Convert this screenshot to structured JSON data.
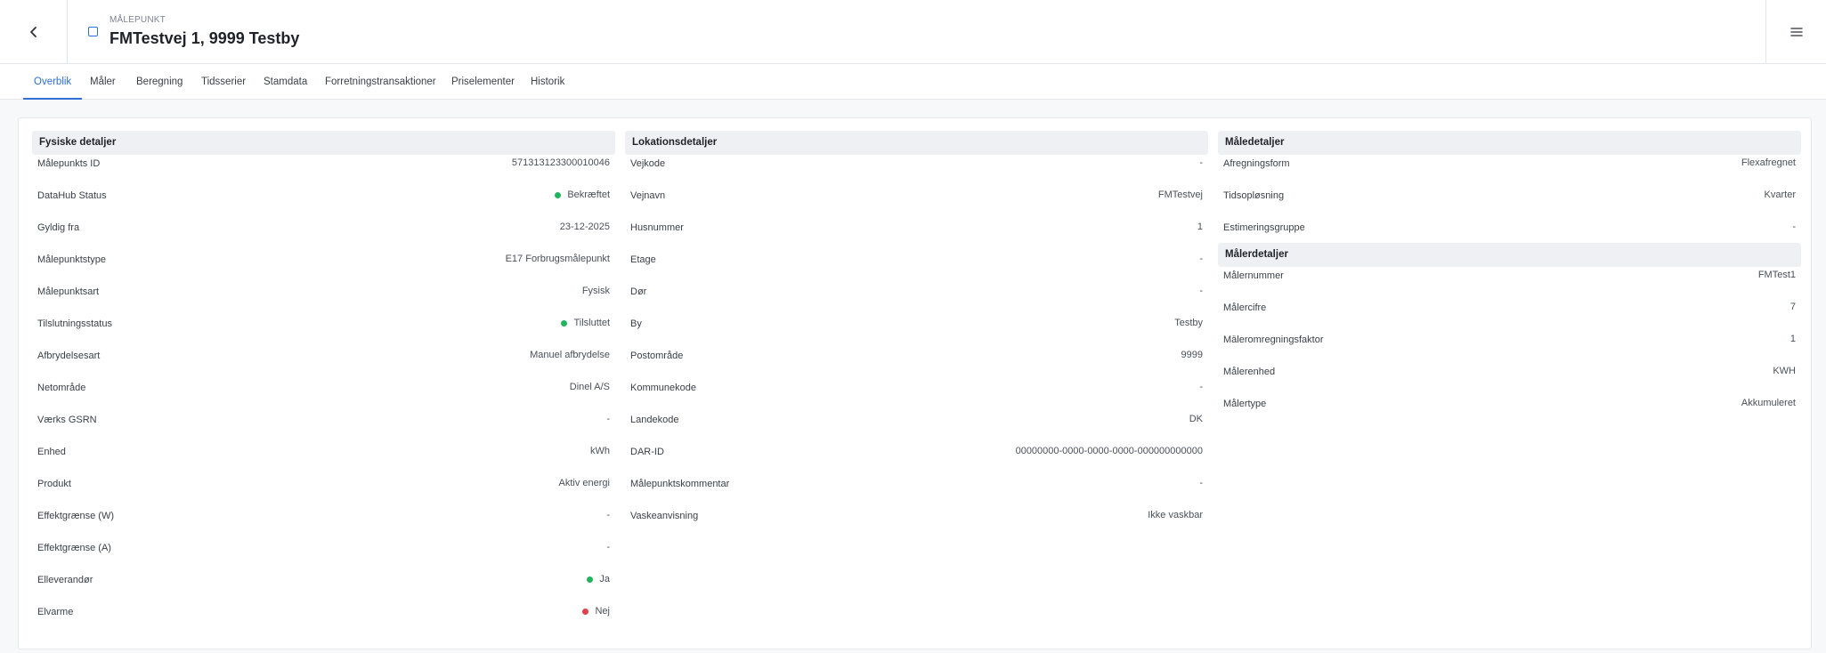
{
  "header": {
    "eyebrow": "MÅLEPUNKT",
    "title": "FMTestvej 1, 9999 Testby"
  },
  "tabs": [
    "Overblik",
    "Måler",
    "Beregning",
    "Tidsserier",
    "Stamdata",
    "Forretningstransaktioner",
    "Priselementer",
    "Historik"
  ],
  "active_tab": "Overblik",
  "physical": {
    "heading": "Fysiske detaljer",
    "rows": [
      {
        "label": "Målepunkts ID",
        "value": "571313123300010046"
      },
      {
        "label": "DataHub Status",
        "value": "Bekræftet",
        "status": "green"
      },
      {
        "label": "Gyldig fra",
        "value": "23-12-2025"
      },
      {
        "label": "Målepunktstype",
        "value": "E17 Forbrugsmålepunkt"
      },
      {
        "label": "Målepunktsart",
        "value": "Fysisk"
      },
      {
        "label": "Tilslutningsstatus",
        "value": "Tilsluttet",
        "status": "green"
      },
      {
        "label": "Afbrydelsesart",
        "value": "Manuel afbrydelse"
      },
      {
        "label": "Netområde",
        "value": "Dinel A/S"
      },
      {
        "label": "Værks GSRN",
        "value": "-"
      },
      {
        "label": "Enhed",
        "value": "kWh"
      },
      {
        "label": "Produkt",
        "value": "Aktiv energi"
      },
      {
        "label": "Effektgrænse (W)",
        "value": "-"
      },
      {
        "label": "Effektgrænse (A)",
        "value": "-"
      },
      {
        "label": "Elleverandør",
        "value": "Ja",
        "status": "green"
      },
      {
        "label": "Elvarme",
        "value": "Nej",
        "status": "red"
      }
    ]
  },
  "location": {
    "heading": "Lokationsdetaljer",
    "rows": [
      {
        "label": "Vejkode",
        "value": "-"
      },
      {
        "label": "Vejnavn",
        "value": "FMTestvej"
      },
      {
        "label": "Husnummer",
        "value": "1"
      },
      {
        "label": "Etage",
        "value": "-"
      },
      {
        "label": "Dør",
        "value": "-"
      },
      {
        "label": "By",
        "value": "Testby"
      },
      {
        "label": "Postområde",
        "value": "9999"
      },
      {
        "label": "Kommunekode",
        "value": "-"
      },
      {
        "label": "Landekode",
        "value": "DK"
      },
      {
        "label": "DAR-ID",
        "value": "00000000-0000-0000-0000-000000000000"
      },
      {
        "label": "Målepunktskommentar",
        "value": "-"
      },
      {
        "label": "Vaskeanvisning",
        "value": "Ikke vaskbar"
      }
    ]
  },
  "measure": {
    "heading": "Måledetaljer",
    "rows": [
      {
        "label": "Afregningsform",
        "value": "Flexafregnet"
      },
      {
        "label": "Tidsopløsning",
        "value": "Kvarter"
      },
      {
        "label": "Estimeringsgruppe",
        "value": "-"
      }
    ]
  },
  "meter": {
    "heading": "Målerdetaljer",
    "rows": [
      {
        "label": "Målernummer",
        "value": "FMTest1"
      },
      {
        "label": "Målercifre",
        "value": "7"
      },
      {
        "label": "Māleromregningsfaktor",
        "value": "1"
      },
      {
        "label": "Målerenhed",
        "value": "KWH"
      },
      {
        "label": "Målertype",
        "value": "Akkumuleret"
      }
    ]
  },
  "icons": {
    "back": "chevron-left-icon",
    "menu": "hamburger-menu-icon"
  },
  "colors": {
    "accent": "#2f6fd6",
    "status_green": "#22b35e",
    "status_red": "#e0404a"
  }
}
